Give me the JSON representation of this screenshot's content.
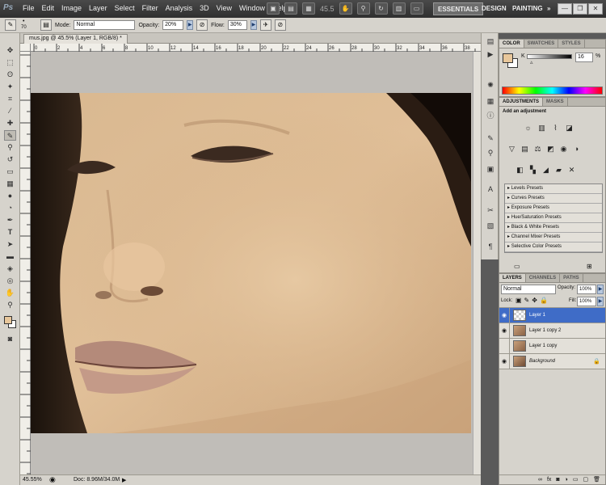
{
  "app": {
    "logo": "Ps"
  },
  "menu": [
    "File",
    "Edit",
    "Image",
    "Layer",
    "Select",
    "Filter",
    "Analysis",
    "3D",
    "View",
    "Window",
    "Help"
  ],
  "menubar": {
    "zoom_value": "45.5",
    "workspaces": [
      "ESSENTIALS",
      "DESIGN",
      "PAINTING",
      "»"
    ],
    "active_workspace": "ESSENTIALS"
  },
  "options": {
    "brush_size": "70",
    "mode_label": "Mode:",
    "mode_value": "Normal",
    "opacity_label": "Opacity:",
    "opacity_value": "20%",
    "flow_label": "Flow:",
    "flow_value": "30%"
  },
  "document": {
    "tab_title": "mus.jpg @ 45.5% (Layer 1, RGB/8) *",
    "zoom": "45.55%",
    "doc_info": "Doc: 8.96M/34.0M",
    "ruler_labels": [
      "0",
      "2",
      "4",
      "6",
      "8",
      "10",
      "12",
      "14",
      "16",
      "18",
      "20",
      "22",
      "24",
      "26",
      "28",
      "30",
      "32",
      "34",
      "36",
      "38"
    ]
  },
  "color_panel": {
    "tabs": [
      "COLOR",
      "SWATCHES",
      "STYLES"
    ],
    "active_tab": "COLOR",
    "channel_label": "K",
    "channel_value": "16",
    "channel_unit": "%",
    "foreground": "#e8c79b",
    "background": "#ffffff"
  },
  "adjustments_panel": {
    "tabs": [
      "ADJUSTMENTS",
      "MASKS"
    ],
    "active_tab": "ADJUSTMENTS",
    "heading": "Add an adjustment",
    "presets": [
      "Levels Presets",
      "Curves Presets",
      "Exposure Presets",
      "Hue/Saturation Presets",
      "Black & White Presets",
      "Channel Mixer Presets",
      "Selective Color Presets"
    ]
  },
  "layers_panel": {
    "tabs": [
      "LAYERS",
      "CHANNELS",
      "PATHS"
    ],
    "active_tab": "LAYERS",
    "blend_mode": "Normal",
    "opacity_label": "Opacity:",
    "opacity_value": "100%",
    "lock_label": "Lock:",
    "fill_label": "Fill:",
    "fill_value": "100%",
    "layers": [
      {
        "name": "Layer 1",
        "selected": true,
        "visible": true
      },
      {
        "name": "Layer 1 copy 2",
        "selected": false,
        "visible": true
      },
      {
        "name": "Layer 1 copy",
        "selected": false,
        "visible": false
      },
      {
        "name": "Background",
        "selected": false,
        "visible": true
      }
    ]
  },
  "colors": {
    "app_bg": "#5a5a5a",
    "panel_bg": "#d6d3cc",
    "selection": "#3f6cc7",
    "skin": "#d9b58e"
  }
}
